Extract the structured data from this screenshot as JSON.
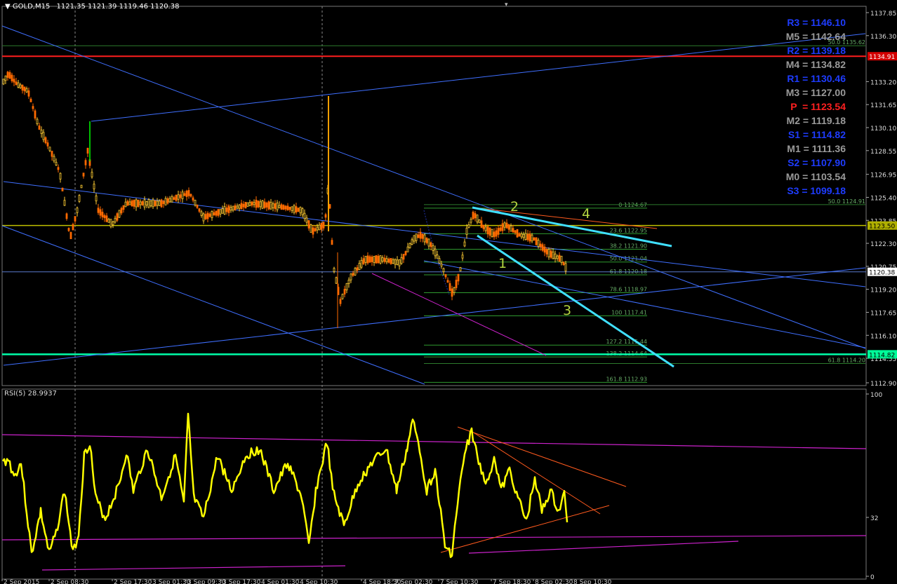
{
  "chart": {
    "symbol_label": "GOLD,M15",
    "ohlc": "1121.35 1121.39 1119.46 1120.38",
    "current_price_label": "1120.38"
  },
  "price_axis": {
    "ticks": [
      "1137.85",
      "1136.30",
      "1133.20",
      "1131.65",
      "1130.10",
      "1128.55",
      "1126.95",
      "1125.40",
      "1123.85",
      "1122.30",
      "1120.75",
      "1119.20",
      "1117.65",
      "1116.10",
      "1114.55",
      "1112.90"
    ],
    "tags": [
      {
        "label": "1134.91",
        "bg": "#d40000",
        "fg": "#ffffff",
        "price": 1134.91
      },
      {
        "label": "1123.50",
        "bg": "#b0b000",
        "fg": "#000000",
        "price": 1123.5
      },
      {
        "label": "1120.38",
        "bg": "#ffffff",
        "fg": "#000000",
        "price": 1120.38
      },
      {
        "label": "1114.82",
        "bg": "#00ff99",
        "fg": "#000000",
        "price": 1114.82
      }
    ]
  },
  "pivots": [
    {
      "label": "R3 = 1146.10",
      "color": "#1e3cff"
    },
    {
      "label": "M5 = 1142.64",
      "color": "#9a9a9a"
    },
    {
      "label": "R2 = 1139.18",
      "color": "#1e3cff"
    },
    {
      "label": "M4 = 1134.82",
      "color": "#9a9a9a"
    },
    {
      "label": "R1 = 1130.46",
      "color": "#1e3cff"
    },
    {
      "label": "M3 = 1127.00",
      "color": "#9a9a9a"
    },
    {
      "label": "P  = 1123.54",
      "color": "#ff2020"
    },
    {
      "label": "M2 = 1119.18",
      "color": "#9a9a9a"
    },
    {
      "label": "S1 = 1114.82",
      "color": "#1e3cff"
    },
    {
      "label": "M1 = 1111.36",
      "color": "#9a9a9a"
    },
    {
      "label": "S2 = 1107.90",
      "color": "#1e3cff"
    },
    {
      "label": "M0 = 1103.54",
      "color": "#9a9a9a"
    },
    {
      "label": "S3 = 1099.18",
      "color": "#1e3cff"
    }
  ],
  "fib_levels": [
    {
      "label": "0 1124.67",
      "price": 1124.67
    },
    {
      "label": "23.6 1122.95",
      "price": 1122.95
    },
    {
      "label": "38.2 1121.90",
      "price": 1121.9
    },
    {
      "label": "50.0 1121.04",
      "price": 1121.04
    },
    {
      "label": "61.8 1120.18",
      "price": 1120.18
    },
    {
      "label": "78.6 1118.97",
      "price": 1118.97
    },
    {
      "label": "100 1117.41",
      "price": 1117.41
    },
    {
      "label": "127.2 1115.44",
      "price": 1115.44
    },
    {
      "label": "138.2 1114.64",
      "price": 1114.64
    },
    {
      "label": "161.8 1112.93",
      "price": 1112.93
    }
  ],
  "fib_extra": [
    {
      "label": "50.0 1135.62",
      "price": 1135.62
    },
    {
      "label": "50.0 1124.91",
      "price": 1124.91
    },
    {
      "label": "61.8 1114.20",
      "price": 1114.2
    }
  ],
  "wave_labels": [
    "1",
    "2",
    "3",
    "4"
  ],
  "rsi": {
    "label": "RSI(5) 28.9937",
    "ticks": [
      "100",
      "32",
      "0"
    ]
  },
  "time_axis": {
    "labels": [
      "2 Sep 2015",
      "2 Sep 08:30",
      "2 Sep 17:30",
      "3 Sep 01:30",
      "3 Sep 09:30",
      "3 Sep 17:30",
      "4 Sep 01:30",
      "4 Sep 10:30",
      "4 Sep 18:30",
      "7 Sep 02:30",
      "7 Sep 10:30",
      "7 Sep 18:30",
      "8 Sep 02:30",
      "8 Sep 10:30"
    ]
  },
  "colors": {
    "pivot_line": "#ff1e1e",
    "yellow_line": "#c0c000",
    "green_line": "#00ffaa",
    "trend_blue": "#3f6fff",
    "cyan": "#40e0ff",
    "magenta": "#cc22cc",
    "rsi_line": "#ffff00",
    "orange": "#ff5a1e",
    "fib_green": "#2f9a2f",
    "wave_label": "#b5d640"
  }
}
